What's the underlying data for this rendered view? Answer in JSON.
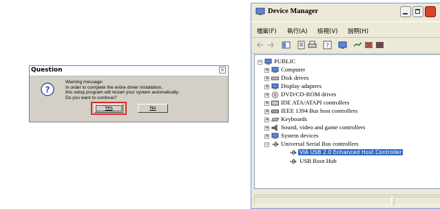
{
  "dialog": {
    "title": "Question",
    "message_lines": [
      "Warning message:",
      "In order to complete the entire driver installation,",
      "this setup program will restart your system automatically.",
      "Do you want to continue?"
    ],
    "yes_label": "Yes",
    "no_label": "No",
    "highlight_color": "#e1261c"
  },
  "device_manager": {
    "title": "Device Manager",
    "menus": [
      "檔案(F)",
      "執行(A)",
      "檢視(V)",
      "說明(H)"
    ],
    "root": "PUBLIC",
    "categories": [
      "Computer",
      "Disk drives",
      "Display adapters",
      "DVD/CD-ROM drives",
      "IDE ATA/ATAPI controllers",
      "IEEE 1394 Bus host controllers",
      "Keyboards",
      "Sound, video and game controllers",
      "System devices",
      "Universal Serial Bus controllers"
    ],
    "usb_children": [
      "VIA USB 2.0 Enhanced Host Controller",
      "USB Root Hub"
    ],
    "selected_item": "VIA USB 2.0 Enhanced Host Controller",
    "selection_color": "#316ac5"
  }
}
